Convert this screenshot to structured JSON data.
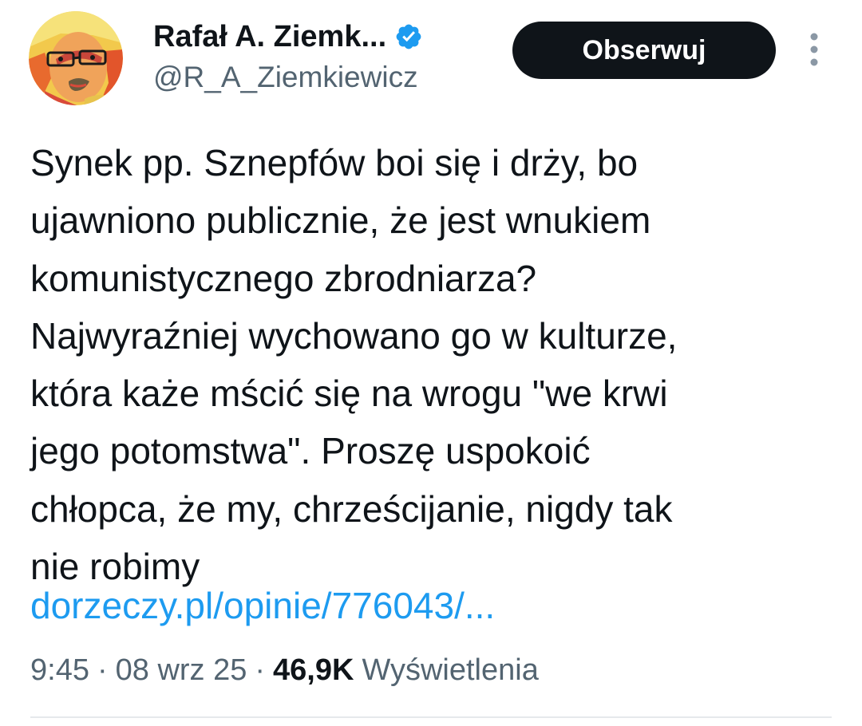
{
  "author": {
    "display_name": "Rafał A. Ziemk...",
    "handle": "@R_A_Ziemkiewicz",
    "verified_icon": "verified-badge-icon",
    "avatar_icon": "profile-avatar"
  },
  "actions": {
    "follow_label": "Obserwuj",
    "more_icon": "more-options-icon"
  },
  "tweet": {
    "lines": [
      "Synek pp. Sznepfów boi się i drży, bo",
      "ujawniono publicznie, że jest wnukiem",
      "komunistycznego zbrodniarza?",
      "Najwyraźniej wychowano go w kulturze,",
      "która każe mścić się na wrogu \"we krwi",
      "jego potomstwa\". Proszę uspokoić",
      "chłopca, że my, chrześcijanie, nigdy tak",
      "nie robimy"
    ],
    "link_text": "dorzeczy.pl/opinie/776043/..."
  },
  "meta": {
    "time": "9:45",
    "separator": "·",
    "date": "08 wrz 25",
    "views_count": "46,9K",
    "views_label": "Wyświetlenia"
  },
  "colors": {
    "text_primary": "#0f1419",
    "text_secondary": "#536471",
    "link": "#1d9bf0",
    "verified": "#1d9bf0",
    "button_bg": "#0f1419",
    "divider": "#e6e9ec"
  }
}
